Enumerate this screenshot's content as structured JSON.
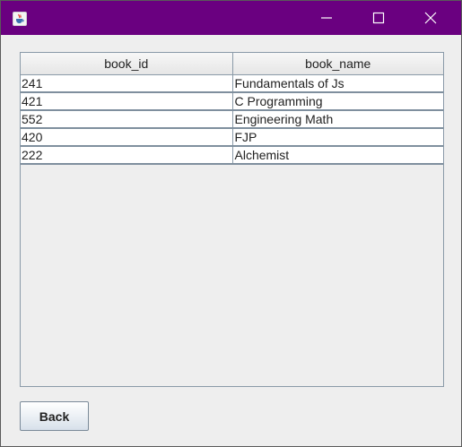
{
  "titlebar": {
    "icons": {
      "app": "java-cup-icon",
      "minimize": "minimize-icon",
      "maximize": "maximize-icon",
      "close": "close-icon"
    },
    "color": "#6a0080"
  },
  "table": {
    "columns": [
      "book_id",
      "book_name"
    ],
    "rows": [
      [
        "241",
        "Fundamentals of Js"
      ],
      [
        "421",
        "C Programming"
      ],
      [
        "552",
        "Engineering Math"
      ],
      [
        "420",
        "FJP"
      ],
      [
        "222",
        "Alchemist"
      ]
    ]
  },
  "buttons": {
    "back_label": "Back"
  }
}
